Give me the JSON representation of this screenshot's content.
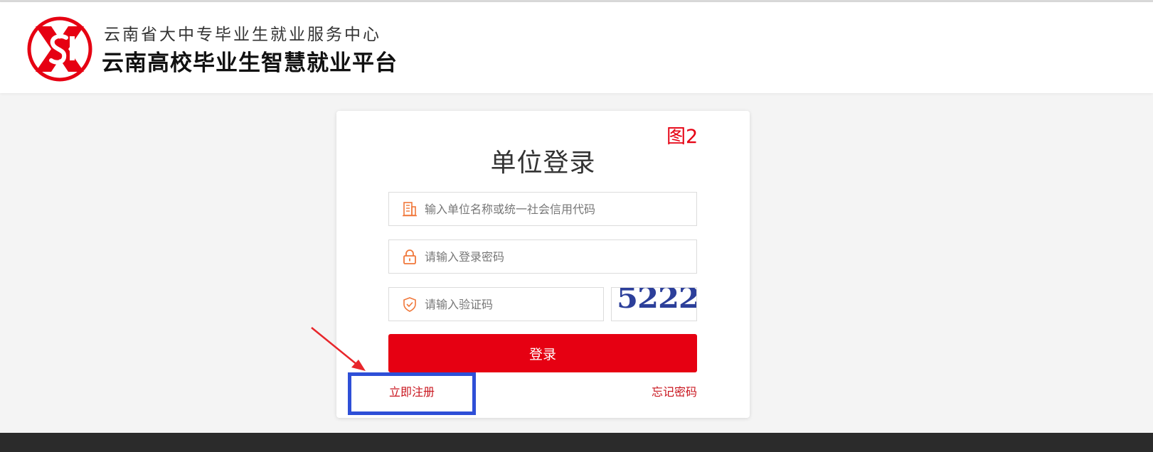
{
  "header": {
    "org_name": "云南省大中专毕业生就业服务中心",
    "platform_name": "云南高校毕业生智慧就业平台",
    "logo_icon": "yunnan-employment-logo"
  },
  "annotation": {
    "figure_label": "图2"
  },
  "login": {
    "title": "单位登录",
    "company_placeholder": "输入单位名称或统一社会信用代码",
    "company_icon": "building-icon",
    "password_placeholder": "请输入登录密码",
    "password_icon": "lock-icon",
    "captcha_placeholder": "请输入验证码",
    "captcha_icon": "shield-check-icon",
    "captcha_code": "5222",
    "submit_label": "登录",
    "register_label": "立即注册",
    "forgot_label": "忘记密码"
  },
  "colors": {
    "brand_red": "#e60012",
    "link_red": "#c9151e",
    "icon_orange": "#f0773a",
    "captcha_blue": "#2c3f9a",
    "highlight_blue": "#2e4fd7"
  }
}
